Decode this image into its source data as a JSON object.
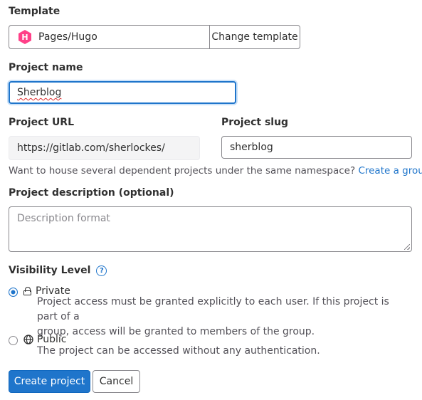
{
  "template": {
    "label": "Template",
    "icon_letter": "H",
    "name": "Pages/Hugo",
    "change_button": "Change template"
  },
  "project_name": {
    "label": "Project name",
    "value": "Sherblog"
  },
  "project_url": {
    "label": "Project URL",
    "value": "https://gitlab.com/sherlockes/"
  },
  "project_slug": {
    "label": "Project slug",
    "value": "sherblog"
  },
  "namespace_hint": {
    "text": "Want to house several dependent projects under the same namespace?",
    "link": "Create a group."
  },
  "description": {
    "label": "Project description (optional)",
    "placeholder": "Description format"
  },
  "visibility": {
    "label": "Visibility Level",
    "help_icon": "?",
    "options": [
      {
        "label": "Private",
        "icon": "lock-icon",
        "selected": true,
        "description_line1": "Project access must be granted explicitly to each user. If this project is part of a",
        "description_line2": "group, access will be granted to members of the group."
      },
      {
        "label": "Public",
        "icon": "globe-icon",
        "selected": false,
        "description_line1": "The project can be accessed without any authentication."
      }
    ]
  },
  "actions": {
    "create": "Create project",
    "cancel": "Cancel"
  },
  "colors": {
    "accent": "#1f75cb",
    "hugo_brand": "#ff4088",
    "text": "#303030",
    "muted": "#535158"
  }
}
